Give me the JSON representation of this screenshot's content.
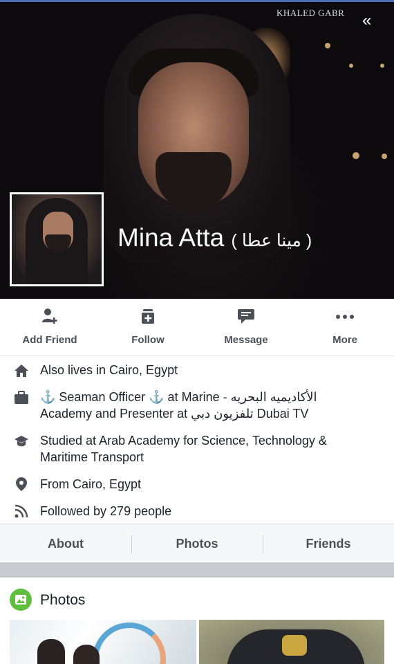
{
  "cover": {
    "watermark": "KHALED GABR",
    "collapse_icon": "«"
  },
  "profile": {
    "name": "Mina Atta",
    "alt_name": "( مينا عطا )"
  },
  "actions": [
    {
      "label": "Add Friend",
      "icon": "add-friend-icon"
    },
    {
      "label": "Follow",
      "icon": "follow-icon"
    },
    {
      "label": "Message",
      "icon": "message-icon"
    },
    {
      "label": "More",
      "icon": "more-icon"
    }
  ],
  "intro": [
    {
      "icon": "home-icon",
      "text": "Also lives in Cairo, Egypt"
    },
    {
      "icon": "briefcase-icon",
      "text": "⚓ Seaman Officer ⚓ at Marine - الأكاديميه البحريه Academy and Presenter at تلفزيون دبي Dubai TV"
    },
    {
      "icon": "graduation-cap-icon",
      "text": "Studied at Arab Academy for Science, Technology & Maritime Transport"
    },
    {
      "icon": "location-pin-icon",
      "text": "From Cairo, Egypt"
    },
    {
      "icon": "rss-feed-icon",
      "text": "Followed by 279 people"
    }
  ],
  "tabs": [
    "About",
    "Photos",
    "Friends"
  ],
  "photos": {
    "title": "Photos"
  },
  "colors": {
    "accent": "#4a6fb5",
    "action_text": "#4b4f56",
    "photos_icon": "#5fbf3c"
  }
}
